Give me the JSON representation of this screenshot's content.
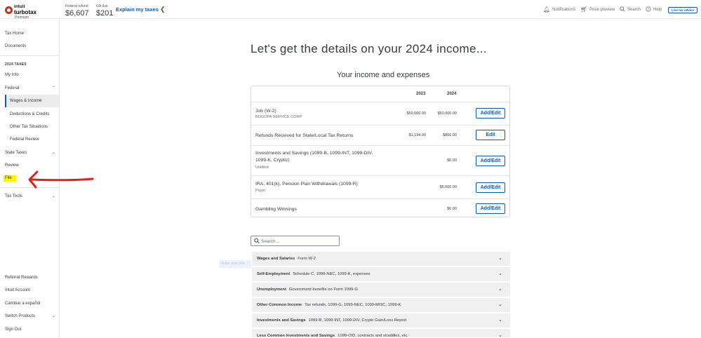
{
  "header": {
    "brand_line1": "intuit",
    "brand_line2": "turbotax",
    "edition": "Premium",
    "federal_refund_label": "Federal refund",
    "federal_refund_amount": "$6,607",
    "state_due_label": "GA due",
    "state_due_amount": "$201",
    "explain_link": "Explain my taxes",
    "nav": {
      "notifications": "Notifications",
      "price_preview": "Price preview",
      "search": "Search",
      "help": "Help",
      "live_advice": "Live tax advice"
    }
  },
  "sidebar": {
    "tax_home": "Tax Home",
    "documents": "Documents",
    "section_header": "2024 TAXES",
    "my_info": "My Info",
    "federal": "Federal",
    "federal_items": [
      "Wages & Income",
      "Deductions & Credits",
      "Other Tax Situations",
      "Federal Review"
    ],
    "state_taxes": "State Taxes",
    "review": "Review",
    "file": "File",
    "tax_tools": "Tax Tools",
    "bottom_items": [
      "Referral Rewards",
      "Intuit Account",
      "Cambiar a español",
      "Switch Products",
      "Sign Out"
    ]
  },
  "main": {
    "title": "Let's get the details on your 2024 income...",
    "subtitle": "Your income and expenses",
    "table": {
      "col_2023": "2023",
      "col_2024": "2024",
      "rows": [
        {
          "name": "Job (W-2)",
          "sub": "BOGOPA SERVICE CORP",
          "v2023": "$50,000.00",
          "v2024": "$50,000.00",
          "action": "Add/Edit"
        },
        {
          "name": "Refunds Received for State/Local Tax Returns",
          "sub": "",
          "v2023": "$1,194.00",
          "v2024": "$866.00",
          "action": "Edit"
        },
        {
          "name": "Investments and Savings (1099-B, 1099-INT, 1099-DIV, 1099-K, Crypto)",
          "sub": "Untitled",
          "v2023": "",
          "v2024": "$0.00",
          "action": "Add/Edit"
        },
        {
          "name": "IRA, 401(k), Pension Plan Withdrawals (1099-R)",
          "sub": "Payer",
          "v2023": "",
          "v2024": "$5,000.00",
          "action": "Add/Edit"
        },
        {
          "name": "Gambling Winnings",
          "sub": "",
          "v2023": "",
          "v2024": "$0.00",
          "action": "Add/Edit"
        }
      ]
    },
    "search_placeholder": "Search...",
    "ghost_label": "Enter your info",
    "categories": [
      {
        "title": "Wages and Salaries",
        "desc": "Form W-2"
      },
      {
        "title": "Self-Employment",
        "desc": "Schedule C, 1099-NEC, 1099-K, expenses"
      },
      {
        "title": "Unemployment",
        "desc": "Government benefits on Form 1099-G"
      },
      {
        "title": "Other Common Income",
        "desc": "Tax refunds, 1099-G, 1099-NEC, 1099-MISC, 1099-K"
      },
      {
        "title": "Investments and Savings",
        "desc": "1099-B, 1099-INT, 1099-DIV, Crypto Gain/Loss Report"
      },
      {
        "title": "Less Common Investments and Savings",
        "desc": "1099-OID, contracts and straddles, etc."
      }
    ]
  },
  "colors": {
    "accent": "#0b5bb5",
    "logo_red": "#d52b1e",
    "annotation_arrow": "#e0201b",
    "highlight": "#fff200"
  }
}
